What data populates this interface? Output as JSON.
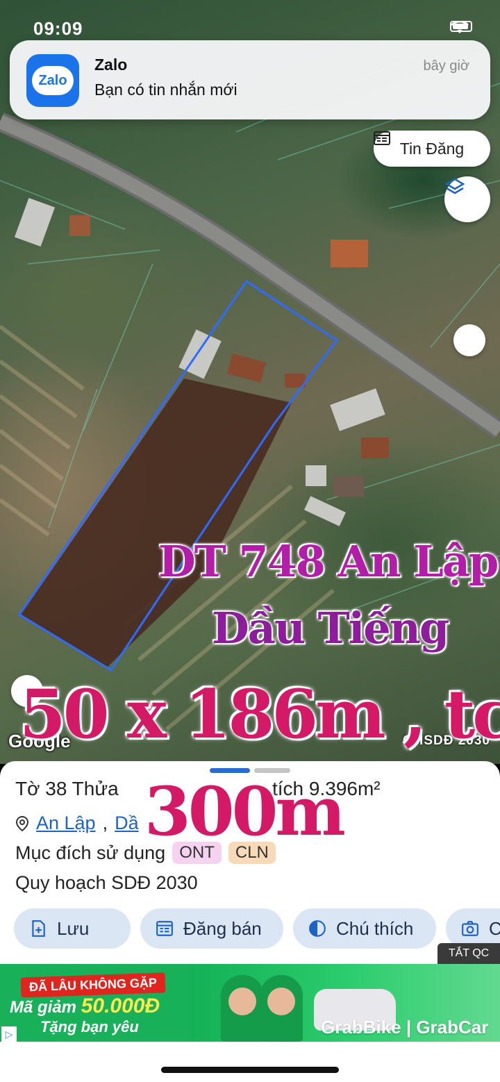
{
  "status_bar": {
    "time": "09:09"
  },
  "notification": {
    "app_icon_text": "Zalo",
    "app": "Zalo",
    "message": "Bạn có tin nhắn mới",
    "time": "bây giờ"
  },
  "map": {
    "tin_dang_label": "Tin Đăng",
    "google_label": "Google",
    "plan_layer_label": "QHSDĐ 2030"
  },
  "overlay_text": {
    "line1": "DT 748 An Lập ,",
    "line2": "Dầu Tiếng",
    "line3": "50 x 186m , tc",
    "line4": "300m"
  },
  "parcel": {
    "sheet_lot": "Tờ 38 Thửa",
    "area": "tích 9.396m²",
    "location_1": "An Lập",
    "location_2": "Dầ",
    "purpose_label": "Mục đích sử dụng",
    "tags": [
      "ONT",
      "CLN"
    ],
    "plan_label": "Quy hoạch SDĐ 2030"
  },
  "actions": [
    {
      "label": "Lưu"
    },
    {
      "label": "Đăng bán"
    },
    {
      "label": "Chú thích"
    },
    {
      "label": "C"
    }
  ],
  "ad": {
    "close_label": "TẮT QC",
    "tag": "ĐÃ LÂU KHÔNG GẶP",
    "promo_prefix": "Mã giảm",
    "promo_value": "50.000Đ",
    "sub": "Tặng bạn yêu",
    "brand": "GrabBike | GrabCar"
  },
  "colors": {
    "accent": "#1d62c7",
    "overlay_pink": "#d41a66",
    "overlay_purple": "#b31ea8",
    "ad_green": "#15b257"
  }
}
